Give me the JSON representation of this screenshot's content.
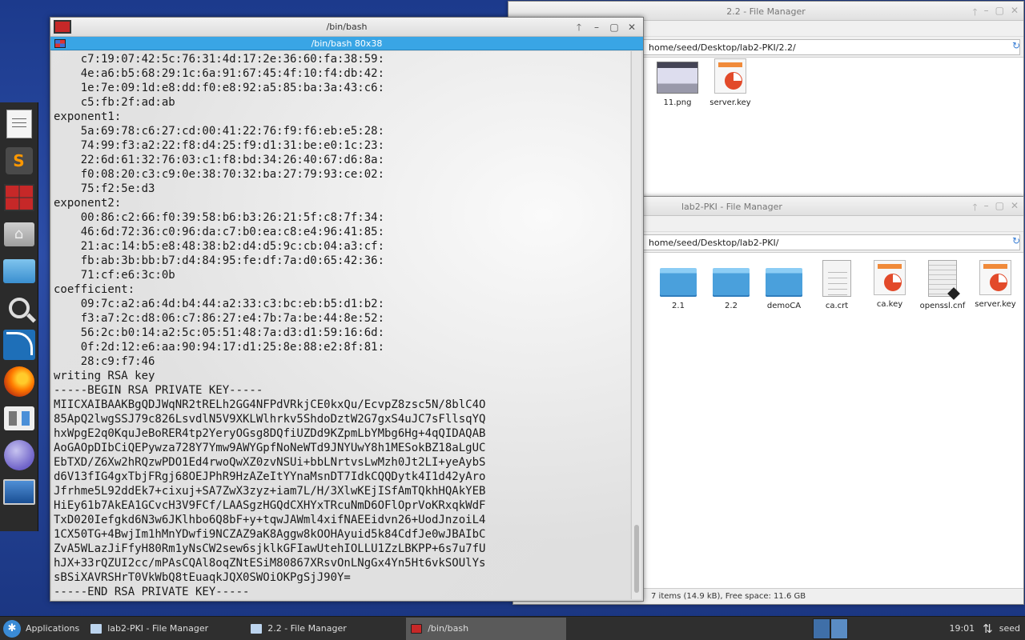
{
  "dock": {
    "items": [
      {
        "name": "text-editor-icon"
      },
      {
        "name": "sublime-text-icon",
        "glyph": "S"
      },
      {
        "name": "terminal-icon"
      },
      {
        "name": "home-folder-icon"
      },
      {
        "name": "file-manager-icon"
      },
      {
        "name": "search-icon"
      },
      {
        "name": "wireshark-icon"
      },
      {
        "name": "firefox-icon"
      },
      {
        "name": "settings-icon"
      },
      {
        "name": "network-icon"
      },
      {
        "name": "desktop-icon"
      }
    ]
  },
  "terminal": {
    "title": "/bin/bash",
    "tab_title": "/bin/bash 80x38",
    "buttons": {
      "up": "🡑",
      "min": "–",
      "max": "▢",
      "close": "✕"
    },
    "lines": [
      "    c7:19:07:42:5c:76:31:4d:17:2e:36:60:fa:38:59:",
      "    4e:a6:b5:68:29:1c:6a:91:67:45:4f:10:f4:db:42:",
      "    1e:7e:09:1d:e8:dd:f0:e8:92:a5:85:ba:3a:43:c6:",
      "    c5:fb:2f:ad:ab",
      "exponent1:",
      "    5a:69:78:c6:27:cd:00:41:22:76:f9:f6:eb:e5:28:",
      "    74:99:f3:a2:22:f8:d4:25:f9:d1:31:be:e0:1c:23:",
      "    22:6d:61:32:76:03:c1:f8:bd:34:26:40:67:d6:8a:",
      "    f0:08:20:c3:c9:0e:38:70:32:ba:27:79:93:ce:02:",
      "    75:f2:5e:d3",
      "exponent2:",
      "    00:86:c2:66:f0:39:58:b6:b3:26:21:5f:c8:7f:34:",
      "    46:6d:72:36:c0:96:da:c7:b0:ea:c8:e4:96:41:85:",
      "    21:ac:14:b5:e8:48:38:b2:d4:d5:9c:cb:04:a3:cf:",
      "    fb:ab:3b:bb:b7:d4:84:95:fe:df:7a:d0:65:42:36:",
      "    71:cf:e6:3c:0b",
      "coefficient:",
      "    09:7c:a2:a6:4d:b4:44:a2:33:c3:bc:eb:b5:d1:b2:",
      "    f3:a7:2c:d8:06:c7:86:27:e4:7b:7a:be:44:8e:52:",
      "    56:2c:b0:14:a2:5c:05:51:48:7a:d3:d1:59:16:6d:",
      "    0f:2d:12:e6:aa:90:94:17:d1:25:8e:88:e2:8f:81:",
      "    28:c9:f7:46",
      "writing RSA key",
      "-----BEGIN RSA PRIVATE KEY-----",
      "MIICXAIBAAKBgQDJWqNR2tRELh2GG4NFPdVRkjCE0kxQu/EcvpZ8zsc5N/8blC4O",
      "85ApQ2lwgSSJ79c826LsvdlN5V9XKLWlhrkv5ShdoDztW2G7gxS4uJC7sFllsqYQ",
      "hxWpgE2q0KquJeBoRER4tp2YeryOGsg8DQfiUZDd9KZpmLbYMbg6Hg+4qQIDAQAB",
      "AoGAOpDIbCiQEPywza728Y7Ymw9AWYGpfNoNeWTd9JNYUwY8h1MESokBZ18aLgUC",
      "EbTXD/Z6Xw2hRQzwPDO1Ed4rwoQwXZ0zvNSUi+bbLNrtvsLwMzh0Jt2LI+yeAybS",
      "d6V13fIG4gxTbjFRgj68OEJPhR9HzAZeItYYnaMsnDT7IdkCQQDytk4I1d42yAro",
      "Jfrhme5L92ddEk7+cixuj+SA7ZwX3zyz+iam7L/H/3XlwKEjISfAmTQkhHQAkYEB",
      "HiEy61b7AkEA1GCvcH3V9FCf/LAASgzHGQdCXHYxTRcuNmD6OFlOprVoKRxqkWdF",
      "TxD020Iefgkd6N3w6JKlhbo6Q8bF+y+tqwJAWml4xifNAEEidvn26+UodJnzoiL4",
      "1CX50TG+4BwjIm1hMnYDwfi9NCZAZ9aK8Aggw8kOOHAyuid5k84CdfJe0wJBAIbC",
      "ZvA5WLazJiFfyH80Rm1yNsCW2sew6sjklkGFIawUtehIOLLU1ZzLBKPP+6s7u7fU",
      "hJX+33rQZUI2cc/mPAsCQAl8oqZNtESiM80867XRsvOnLNgGx4Yn5Ht6vkSOUlYs",
      "sBSiXAVRSHrT0VkWbQ8tEuaqkJQX0SWOiOKPgSjJ90Y=",
      "-----END RSA PRIVATE KEY-----"
    ]
  },
  "fm_top": {
    "title": "2.2 - File Manager",
    "path": "home/seed/Desktop/lab2-PKI/2.2/",
    "refresh_icon": "↻",
    "items": [
      {
        "label": "11.png",
        "kind": "png"
      },
      {
        "label": "server.key",
        "kind": "key"
      }
    ]
  },
  "fm_bottom": {
    "title": "lab2-PKI - File Manager",
    "path": "home/seed/Desktop/lab2-PKI/",
    "refresh_icon": "↻",
    "items": [
      {
        "label": "2.1",
        "kind": "folder"
      },
      {
        "label": "2.2",
        "kind": "folder"
      },
      {
        "label": "demoCA",
        "kind": "folder"
      },
      {
        "label": "ca.crt",
        "kind": "doc"
      },
      {
        "label": "ca.key",
        "kind": "key"
      },
      {
        "label": "openssl.cnf",
        "kind": "cnf"
      },
      {
        "label": "server.key",
        "kind": "key"
      }
    ],
    "status": "7 items (14.9 kB), Free space: 11.6 GB"
  },
  "fm_buttons": {
    "up": "🡑",
    "min": "–",
    "max": "▢",
    "close": "✕"
  },
  "taskbar": {
    "apps_label": "Applications",
    "tasks": [
      {
        "label": "lab2-PKI - File Manager",
        "kind": "folder",
        "active": false
      },
      {
        "label": "2.2 - File Manager",
        "kind": "folder",
        "active": false
      },
      {
        "label": "/bin/bash",
        "kind": "term",
        "active": true
      }
    ],
    "clock": "19:01",
    "network_glyph": "⇅",
    "user": "seed"
  },
  "colors": {
    "terminal_tab": "#39a5e5",
    "desktop": "#2d4ea8",
    "taskbar": "#2f2f2f"
  }
}
